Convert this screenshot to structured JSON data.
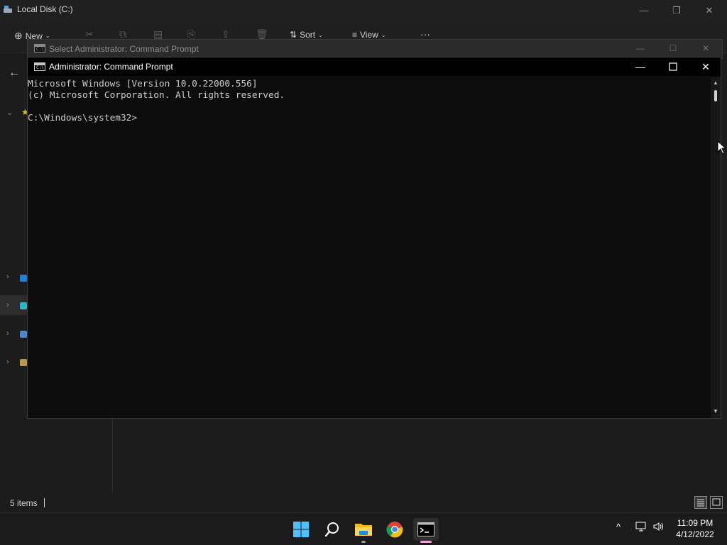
{
  "explorer": {
    "title": "Local Disk (C:)",
    "toolbar": {
      "new_label": "New",
      "sort_label": "Sort",
      "view_label": "View",
      "more_label": "···"
    },
    "status": {
      "items_count": "5 items"
    }
  },
  "ghost_window": {
    "title": "Select Administrator: Command Prompt"
  },
  "cmd": {
    "title": "Administrator: Command Prompt",
    "lines": [
      "Microsoft Windows [Version 10.0.22000.556]",
      "(c) Microsoft Corporation. All rights reserved.",
      "",
      "C:\\Windows\\system32>"
    ]
  },
  "taskbar": {
    "apps": [
      "start-icon",
      "search-icon",
      "file-explorer-icon",
      "chrome-icon",
      "command-prompt-icon"
    ],
    "active_app": "command-prompt-icon",
    "time": "11:09 PM",
    "date": "4/12/2022"
  },
  "colors": {
    "accent": "#f0a8d8",
    "console_bg": "#0c0c0c",
    "console_text": "#cccccc",
    "taskbar_bg": "#1b1b1b"
  }
}
